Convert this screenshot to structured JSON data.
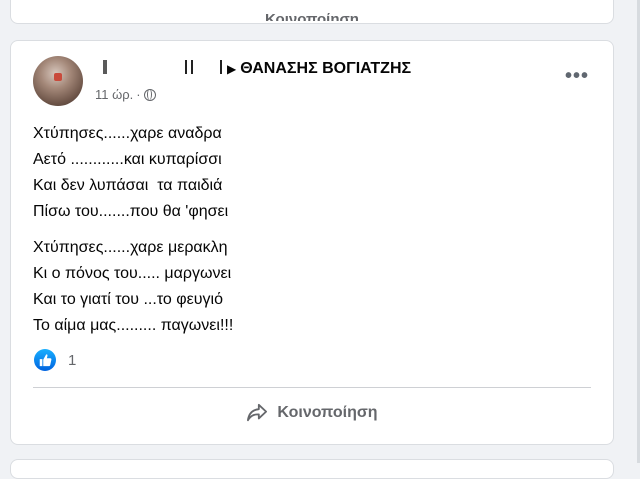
{
  "previous_post": {
    "share_label": "Κοινοποίηση"
  },
  "post": {
    "author": "ΘΑΝΑΣΗΣ ΒΟΓΙΑΤΖΗΣ",
    "timestamp": "11 ώρ.",
    "separator": "·",
    "privacy_icon": "globe-icon",
    "more_icon": "more-options-icon",
    "more_label": "•••",
    "stanzas": [
      {
        "lines": [
          "Χτύπησες......χαρε αναδρα",
          "Αετό ............και κυπαρίσσι",
          "Και δεν λυπάσαι  τα παιδιά",
          "Πίσω του.......που θα 'φησει"
        ]
      },
      {
        "lines": [
          "Χτύπησες......χαρε μερακλη",
          "Κι ο πόνος του..... μαργωνει",
          "Και το γιατί του ...το φευγιό",
          "Το αίμα μας......... παγωνει!!!"
        ]
      }
    ],
    "reactions": {
      "icon": "like-icon",
      "count": "1"
    },
    "share": {
      "icon": "share-arrow-icon",
      "label": "Κοινοποίηση"
    }
  },
  "colors": {
    "background": "#f0f2f5",
    "card": "#ffffff",
    "text": "#050505",
    "secondary_text": "#65676b",
    "like_blue": "#1877f2"
  }
}
